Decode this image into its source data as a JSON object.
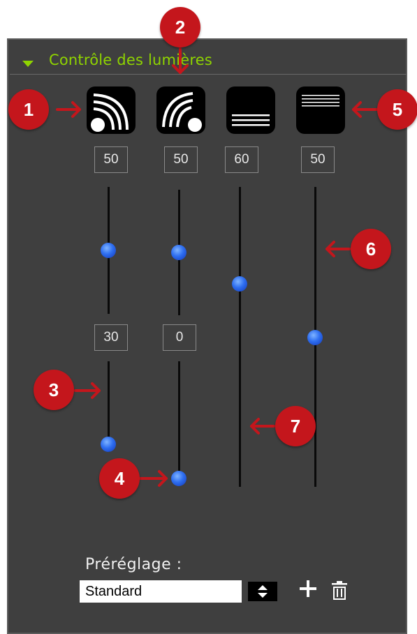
{
  "panel": {
    "title": "Contrôle des lumières"
  },
  "light_buttons": [
    {
      "icon": "key-light-wide-icon"
    },
    {
      "icon": "key-light-narrow-icon"
    },
    {
      "icon": "fill-light-bottom-icon"
    },
    {
      "icon": "fill-light-top-icon"
    }
  ],
  "values": {
    "light1_intensity": "50",
    "light2_intensity": "50",
    "light3_intensity": "60",
    "light4_intensity": "50",
    "light1_second": "30",
    "light2_second": "0"
  },
  "sliders": {
    "light1_intensity": 0.5,
    "light2_intensity": 0.5,
    "light3_intensity": 0.6,
    "light4_intensity": 0.5,
    "light1_second": 0.3,
    "light2_second": 0
  },
  "callouts": [
    "1",
    "2",
    "3",
    "4",
    "5",
    "6",
    "7"
  ],
  "preset": {
    "label": "Préréglage :",
    "value": "Standard"
  },
  "colors": {
    "panel_bg": "#3f3f3f",
    "title_green": "#8fd400",
    "callout_red": "#c4161c",
    "thumb_blue": "#2e6ef0"
  }
}
